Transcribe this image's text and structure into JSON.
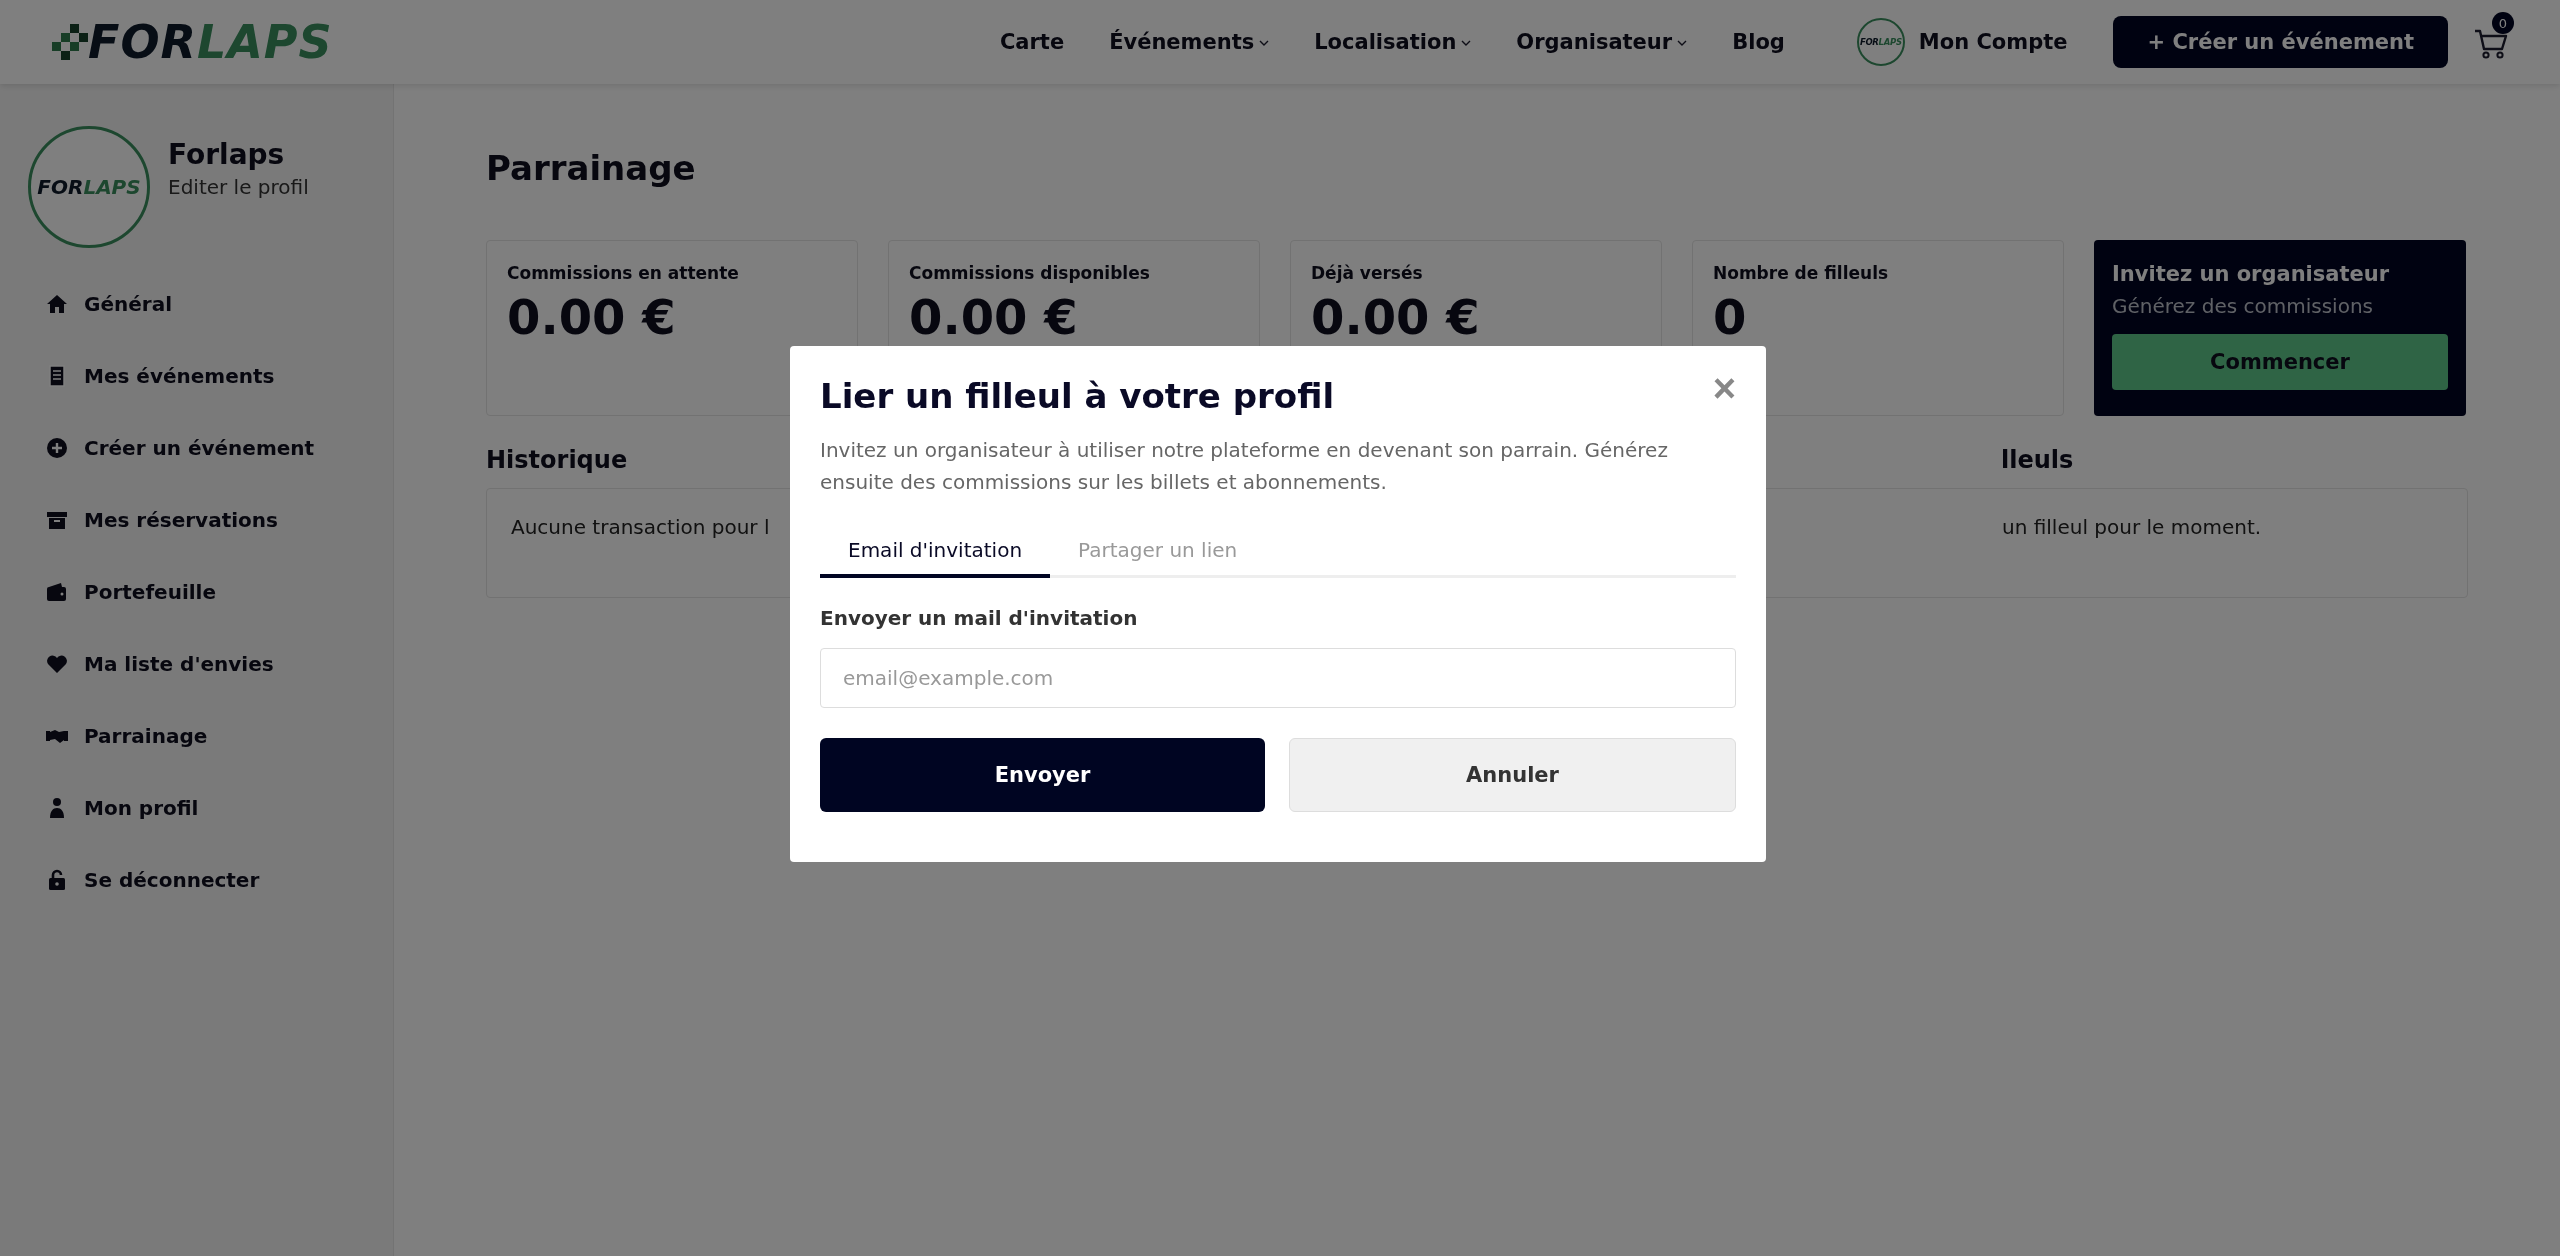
{
  "header": {
    "logo": {
      "part_1": "FOR",
      "part_2": "LAPS"
    },
    "nav": [
      {
        "label": "Carte",
        "dropdown": false
      },
      {
        "label": "Événements",
        "dropdown": true
      },
      {
        "label": "Localisation",
        "dropdown": true
      },
      {
        "label": "Organisateur",
        "dropdown": true
      },
      {
        "label": "Blog",
        "dropdown": false
      }
    ],
    "account": {
      "avatar_logo": {
        "part_1": "FOR",
        "part_2": "LAPS"
      },
      "label": "Mon Compte"
    },
    "create_button": "+ Créer un événement",
    "cart_count": "0"
  },
  "sidebar": {
    "avatar_logo": {
      "part_1": "FOR",
      "part_2": "LAPS"
    },
    "name": "Forlaps",
    "edit_link": "Editer le profil",
    "items": [
      {
        "label": "Général",
        "kind": "home"
      },
      {
        "label": "Mes événements",
        "kind": "document"
      },
      {
        "label": "Créer un événement",
        "kind": "plus"
      },
      {
        "label": "Mes réservations",
        "kind": "archive"
      },
      {
        "label": "Portefeuille",
        "kind": "wallet"
      },
      {
        "label": "Ma liste d'envies",
        "kind": "heart"
      },
      {
        "label": "Parrainage",
        "kind": "handshake"
      },
      {
        "label": "Mon profil",
        "kind": "person"
      },
      {
        "label": "Se déconnecter",
        "kind": "lock"
      }
    ]
  },
  "page": {
    "title": "Parrainage",
    "stats": [
      {
        "label": "Commissions en attente",
        "value": "0.00 €"
      },
      {
        "label": "Commissions disponibles",
        "value": "0.00 €"
      },
      {
        "label": "Déjà versés",
        "value": "0.00 €"
      },
      {
        "label": "Nombre de filleuls",
        "value": "0"
      }
    ],
    "invite_card": {
      "title": "Invitez un organisateur",
      "subtitle": "Générez des commissions",
      "button": "Commencer"
    },
    "history": {
      "heading": "Historique",
      "empty_text": "Aucune transaction pour l"
    },
    "referrals": {
      "heading": "lleuls",
      "empty_text": "un filleul pour le moment."
    }
  },
  "modal": {
    "title": "Lier un filleul à votre profil",
    "close": "×",
    "description": "Invitez un organisateur à utiliser notre plateforme en devenant son parrain. Générez ensuite des commissions sur les billets et abonnements.",
    "tabs": [
      {
        "label": "Email d'invitation",
        "selected": true
      },
      {
        "label": "Partager un lien",
        "selected": false
      }
    ],
    "field_label": "Envoyer un mail d'invitation",
    "placeholder": "email@example.com",
    "submit": "Envoyer",
    "cancel": "Annuler"
  }
}
